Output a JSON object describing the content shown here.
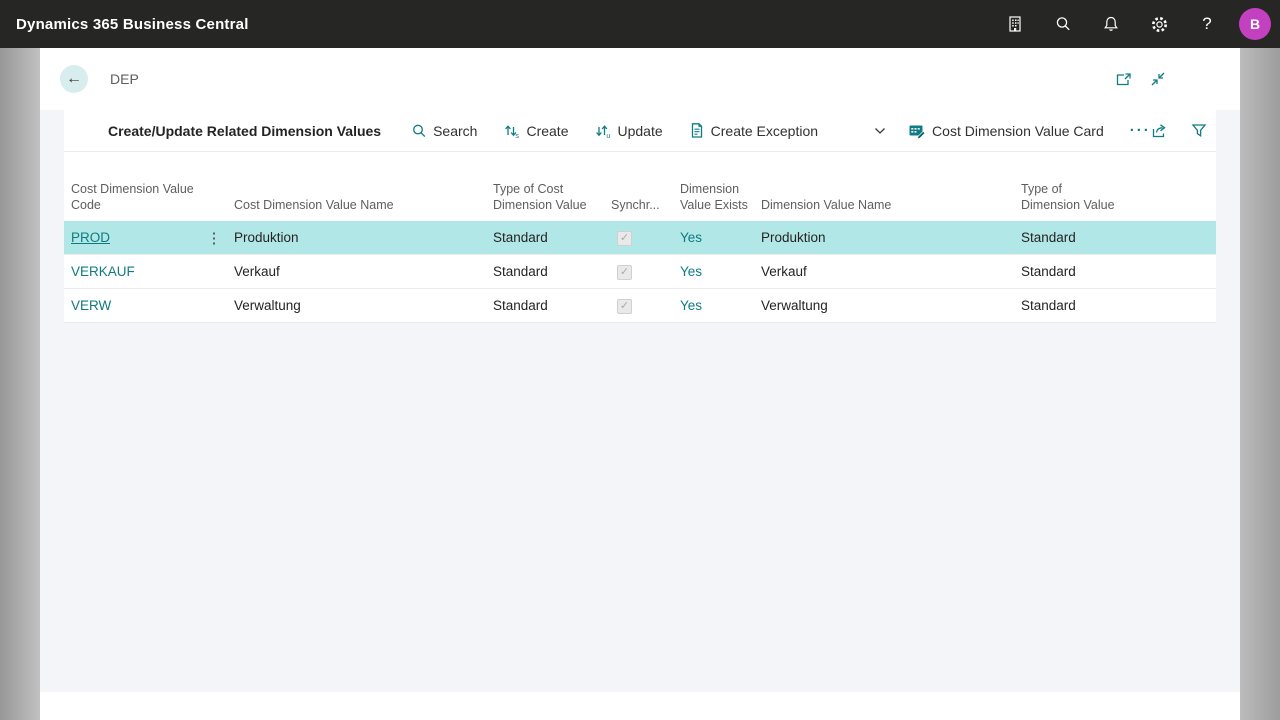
{
  "colors": {
    "topbar_bg": "#262625",
    "accent_teal": "#0e7c84",
    "selected_row_bg": "#b2e7e8",
    "avatar_bg": "#c340c0",
    "content_bg": "#f4f5f8",
    "header_text": "#605e5c"
  },
  "topbar": {
    "title": "Dynamics 365 Business Central",
    "icons": [
      "company-icon",
      "search-icon",
      "notifications-icon",
      "settings-icon",
      "help-icon"
    ],
    "help_glyph": "?",
    "avatar_initial": "B"
  },
  "page_header": {
    "title": "DEP",
    "back_glyph": "←",
    "window_icons": [
      "open-in-window-icon",
      "exit-fullscreen-icon"
    ]
  },
  "action_bar": {
    "caption": "Create/Update Related Dimension Values",
    "actions": [
      {
        "label": "Search",
        "icon": "search-icon"
      },
      {
        "label": "Create",
        "icon": "create-icon"
      },
      {
        "label": "Update",
        "icon": "update-icon"
      },
      {
        "label": "Create Exception",
        "icon": "create-exception-icon"
      },
      {
        "label": "Cost Dimension Value Card",
        "icon": "value-card-icon"
      }
    ],
    "more_label": "···",
    "right_icons": [
      "share-icon",
      "filter-icon"
    ]
  },
  "table": {
    "columns": [
      {
        "label": "Cost Dimension Value Code"
      },
      {
        "label": ""
      },
      {
        "label": "Cost Dimension Value Name"
      },
      {
        "label": "Type of Cost Dimension Value"
      },
      {
        "label": "Synchr..."
      },
      {
        "label": "Dimension Value Exists"
      },
      {
        "label": "Dimension Value Name"
      },
      {
        "label": "Type of Dimension Value"
      }
    ],
    "rows": [
      {
        "code": "PROD",
        "name": "Produktion",
        "type": "Standard",
        "synchronized": true,
        "exists": "Yes",
        "dim_name": "Produktion",
        "dim_type": "Standard",
        "selected": true
      },
      {
        "code": "VERKAUF",
        "name": "Verkauf",
        "type": "Standard",
        "synchronized": true,
        "exists": "Yes",
        "dim_name": "Verkauf",
        "dim_type": "Standard",
        "selected": false
      },
      {
        "code": "VERW",
        "name": "Verwaltung",
        "type": "Standard",
        "synchronized": true,
        "exists": "Yes",
        "dim_name": "Verwaltung",
        "dim_type": "Standard",
        "selected": false
      }
    ],
    "check_glyph": "✓",
    "row_menu_glyph": "⋮"
  }
}
